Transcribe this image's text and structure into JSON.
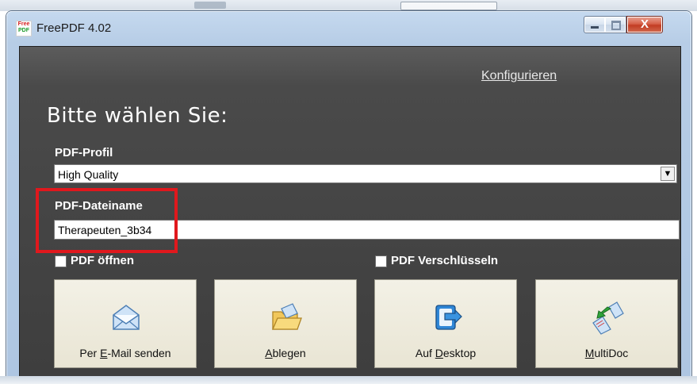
{
  "window": {
    "title": "FreePDF 4.02",
    "icon_text_top": "Free",
    "icon_text_bottom": "PDF",
    "controls": {
      "close_glyph": "X"
    }
  },
  "header": {
    "configure_link": "Konfigurieren",
    "heading": "Bitte wählen Sie:"
  },
  "profile": {
    "label": "PDF-Profil",
    "selected": "High Quality",
    "arrow_glyph": "▼"
  },
  "filename": {
    "label": "PDF-Dateiname",
    "value": "Therapeuten_3b34"
  },
  "options": {
    "open_pdf": {
      "label": "PDF öffnen",
      "checked": false
    },
    "encrypt_pdf": {
      "label": "PDF Verschlüsseln",
      "checked": false
    }
  },
  "actions": [
    {
      "label_pre": "Per ",
      "label_accel": "E",
      "label_post": "-Mail senden",
      "icon": "email-envelope-icon"
    },
    {
      "label_pre": "",
      "label_accel": "A",
      "label_post": "blegen",
      "icon": "folder-icon"
    },
    {
      "label_pre": "Auf ",
      "label_accel": "D",
      "label_post": "esktop",
      "icon": "desktop-icon"
    },
    {
      "label_pre": "",
      "label_accel": "M",
      "label_post": "ultiDoc",
      "icon": "multidoc-icon"
    }
  ],
  "colors": {
    "highlight": "#e0181d",
    "client_bg": "#4a4a4a",
    "button_bg": "#ece8d8"
  }
}
